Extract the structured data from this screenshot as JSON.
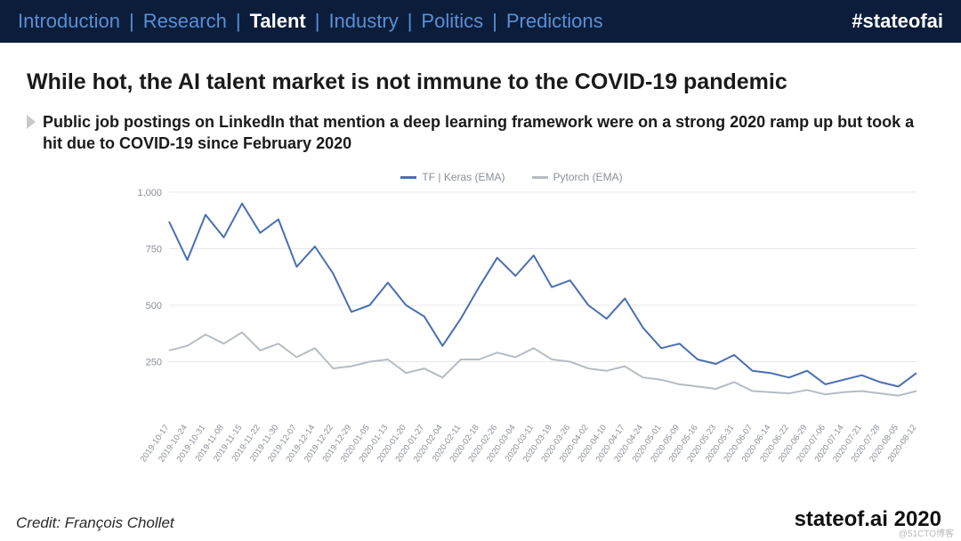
{
  "nav": {
    "items": [
      "Introduction",
      "Research",
      "Talent",
      "Industry",
      "Politics",
      "Predictions"
    ],
    "active_index": 2,
    "hashtag": "#stateofai"
  },
  "title": "While hot, the AI talent market is not immune to the COVID-19 pandemic",
  "subtitle": "Public job postings on LinkedIn that mention a deep learning framework were on a strong 2020 ramp up but took a hit due to COVID-19 since February 2020",
  "credit": "Credit: François Chollet",
  "brand": "stateof.ai 2020",
  "watermark": "@51CTO博客",
  "chart_data": {
    "type": "line",
    "title": "",
    "xlabel": "",
    "ylabel": "",
    "ylim": [
      0,
      1000
    ],
    "y_ticks": [
      250,
      500,
      750,
      1000
    ],
    "y_tick_labels": [
      "250",
      "500",
      "750",
      "1,000"
    ],
    "legend_position": "top",
    "categories": [
      "2019-10-17",
      "2019-10-24",
      "2019-10-31",
      "2019-11-08",
      "2019-11-15",
      "2019-11-22",
      "2019-11-30",
      "2019-12-07",
      "2019-12-14",
      "2019-12-22",
      "2019-12-29",
      "2020-01-05",
      "2020-01-13",
      "2020-01-20",
      "2020-01-27",
      "2020-02-04",
      "2020-02-11",
      "2020-02-18",
      "2020-02-26",
      "2020-03-04",
      "2020-03-11",
      "2020-03-19",
      "2020-03-26",
      "2020-04-02",
      "2020-04-10",
      "2020-04-17",
      "2020-04-24",
      "2020-05-01",
      "2020-05-09",
      "2020-05-16",
      "2020-05-23",
      "2020-05-31",
      "2020-06-07",
      "2020-06-14",
      "2020-06-22",
      "2020-06-29",
      "2020-07-06",
      "2020-07-14",
      "2020-07-21",
      "2020-07-28",
      "2020-08-05",
      "2020-08-12"
    ],
    "series": [
      {
        "name": "TF | Keras (EMA)",
        "color": "#4a6fb0",
        "values": [
          870,
          700,
          900,
          800,
          950,
          820,
          880,
          670,
          760,
          640,
          470,
          500,
          600,
          500,
          450,
          320,
          440,
          580,
          710,
          630,
          720,
          580,
          610,
          500,
          440,
          530,
          400,
          310,
          330,
          260,
          240,
          280,
          210,
          200,
          180,
          210,
          150,
          170,
          190,
          160,
          140,
          200
        ]
      },
      {
        "name": "Pytorch (EMA)",
        "color": "#b6bcc4",
        "values": [
          300,
          320,
          370,
          330,
          380,
          300,
          330,
          270,
          310,
          220,
          230,
          250,
          260,
          200,
          220,
          180,
          260,
          260,
          290,
          270,
          310,
          260,
          250,
          220,
          210,
          230,
          180,
          170,
          150,
          140,
          130,
          160,
          120,
          115,
          110,
          125,
          105,
          115,
          120,
          110,
          100,
          120
        ]
      }
    ]
  }
}
